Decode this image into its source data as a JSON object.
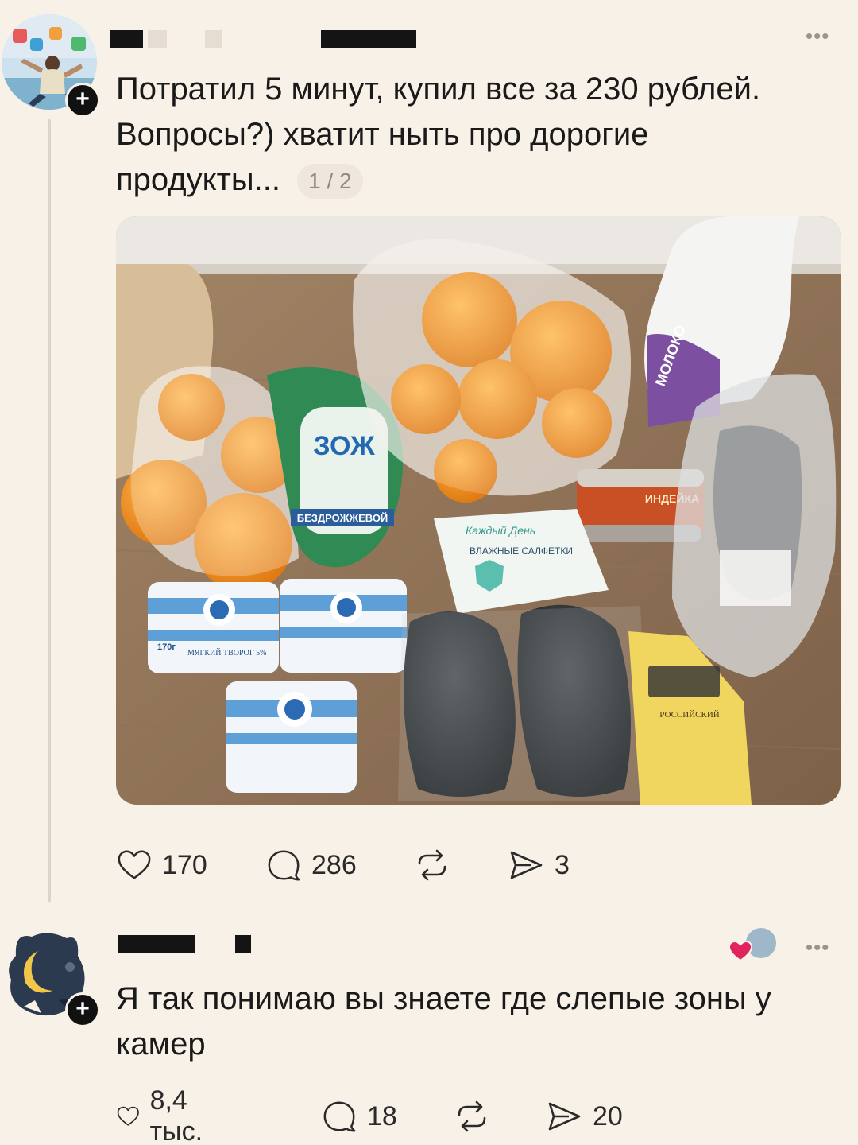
{
  "post": {
    "text": "Потратил 5 минут, купил все за 230 рублей. Вопросы?) хватит ныть про дорогие продукты...",
    "page_counter": "1 / 2",
    "actions": {
      "likes": "170",
      "comments": "286",
      "reposts": "",
      "shares": "3"
    },
    "photo_labels": {
      "bread_brand": "ЗОЖ",
      "bread_sub": "БЕЗДРОЖЖЕВОЙ",
      "wipes": "ВЛАЖНЫЕ САЛФЕТКИ",
      "wipes_brand": "Каждый День",
      "can": "ИНДЕЙКА",
      "milk": "МОЛОКО",
      "cheese": "РОССИЙСКИЙ",
      "cottage_cheese": "МЯГКИЙ ТВОРОГ 5%",
      "cottage_weight": "170г"
    }
  },
  "reply": {
    "text": "Я так понимаю вы знаете где слепые зоны у камер",
    "actions": {
      "likes": "8,4 тыс.",
      "comments": "18",
      "reposts": "",
      "shares": "20"
    }
  },
  "icons": {
    "more": "more-icon",
    "like": "heart-icon",
    "comment": "comment-icon",
    "repost": "repost-icon",
    "share": "share-icon",
    "follow": "plus-icon"
  },
  "colors": {
    "background": "#f8f1e8",
    "text": "#1a1a1a",
    "muted": "#9a948d",
    "liked_heart": "#e0245e"
  }
}
